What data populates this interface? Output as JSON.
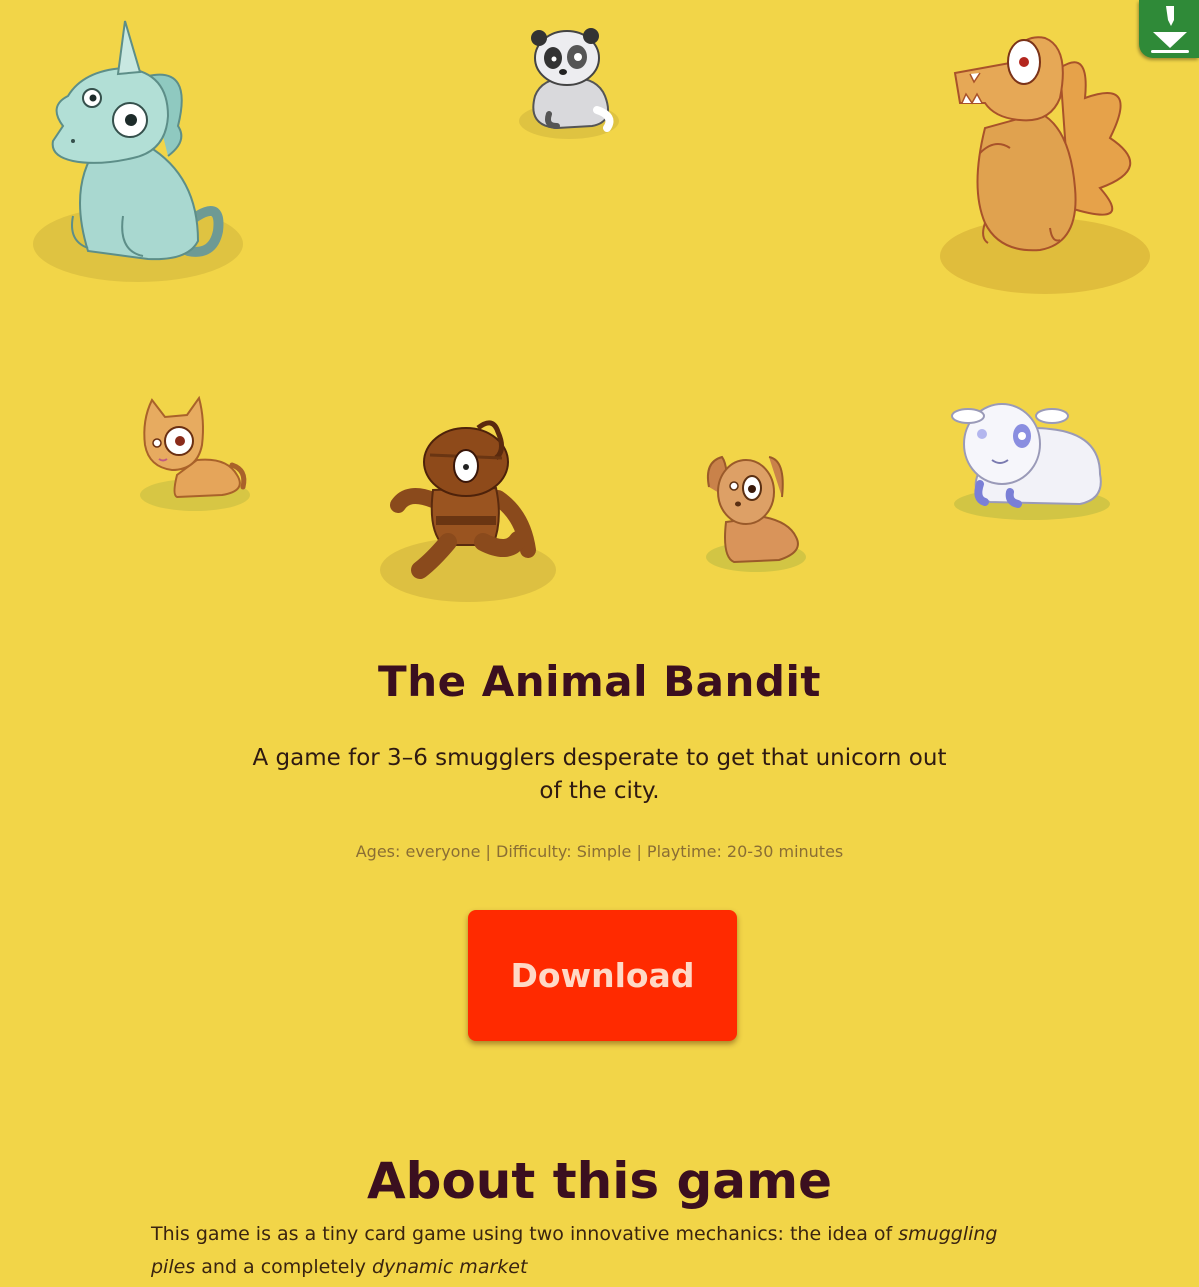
{
  "title": "The Animal Bandit",
  "tagline": "A game for 3–6 smugglers desperate to get that unicorn out of the city.",
  "meta": {
    "ages": "Ages: everyone",
    "separator": "|",
    "difficulty": "Difficulty: Simple",
    "playtime": "Playtime: 20-30 minutes"
  },
  "download": {
    "label": "Download"
  },
  "about": {
    "heading": "About this game",
    "text_before": "This game is as a tiny card game using two innovative mechanics: the idea of ",
    "emphasis_1": "smuggling piles",
    "text_middle": " and a completely ",
    "emphasis_2": "dynamic market"
  },
  "illustrations": [
    "unicorn",
    "panda",
    "dragon",
    "cat",
    "ninja-bandit",
    "puppy",
    "sheep"
  ],
  "corner_badge_icon": "download-arrow-icon",
  "colors": {
    "background": "#f2d548",
    "title": "#3b0f1f",
    "button": "#ff2a00",
    "button_text": "#ffd9c6",
    "meta_text": "#8a6e34",
    "badge": "#2f8a38"
  }
}
